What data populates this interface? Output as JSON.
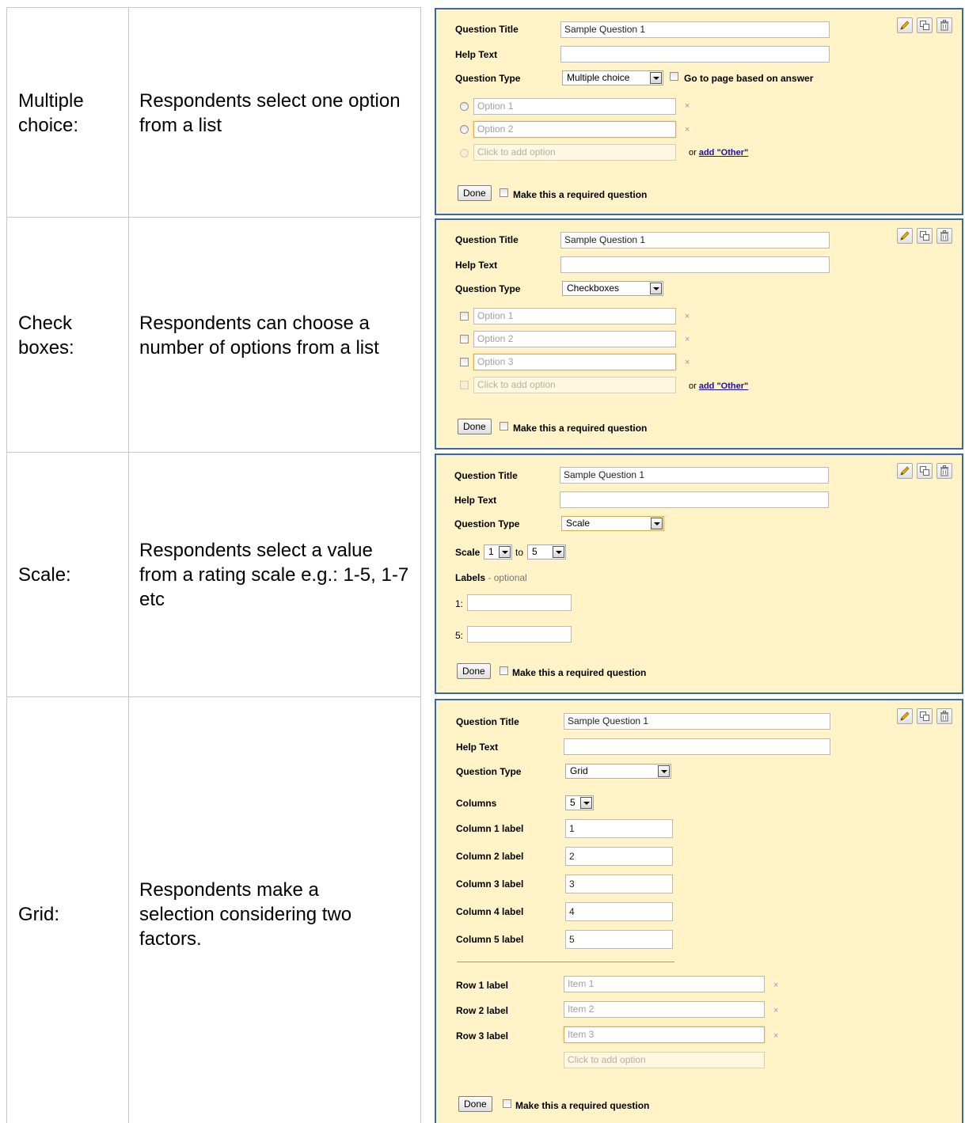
{
  "rows": [
    {
      "type_label": "Multiple choice:",
      "description": "Respondents select one option from a list"
    },
    {
      "type_label": "Check boxes:",
      "description": "Respondents can choose a number of options from a list"
    },
    {
      "type_label": "Scale:",
      "description": "Respondents select a value from a rating scale e.g.: 1-5, 1-7 etc"
    },
    {
      "type_label": "Grid:",
      "description": "Respondents make a selection considering two factors."
    }
  ],
  "common": {
    "question_title_label": "Question Title",
    "question_title_value": "Sample Question 1",
    "help_text_label": "Help Text",
    "help_text_value": "",
    "question_type_label": "Question Type",
    "done_label": "Done",
    "required_label": "Make this a required question",
    "remove_symbol": "×",
    "click_to_add_option": "Click to add option",
    "or_text": "or",
    "add_other": "add \"Other\"",
    "icons": [
      "edit-pencil-icon",
      "duplicate-icon",
      "delete-trash-icon"
    ]
  },
  "multiple_choice": {
    "question_type_value": "Multiple choice",
    "go_to_page_label": "Go to page based on answer",
    "options": [
      "Option 1",
      "Option 2"
    ]
  },
  "checkboxes": {
    "question_type_value": "Checkboxes",
    "options": [
      "Option 1",
      "Option 2",
      "Option 3"
    ]
  },
  "scale": {
    "question_type_value": "Scale",
    "scale_label": "Scale",
    "scale_from": "1",
    "to_label": "to",
    "scale_to": "5",
    "labels_label": "Labels",
    "labels_optional": "- optional",
    "low_label_prefix": "1:",
    "high_label_prefix": "5:"
  },
  "grid": {
    "question_type_value": "Grid",
    "columns_label": "Columns",
    "columns_value": "5",
    "column_labels": [
      {
        "label": "Column 1 label",
        "value": "1"
      },
      {
        "label": "Column 2 label",
        "value": "2"
      },
      {
        "label": "Column 3 label",
        "value": "3"
      },
      {
        "label": "Column 4 label",
        "value": "4"
      },
      {
        "label": "Column 5 label",
        "value": "5"
      }
    ],
    "row_labels": [
      {
        "label": "Row 1 label",
        "value": "Item 1"
      },
      {
        "label": "Row 2 label",
        "value": "Item 2"
      },
      {
        "label": "Row 3 label",
        "value": "Item 3"
      }
    ]
  }
}
